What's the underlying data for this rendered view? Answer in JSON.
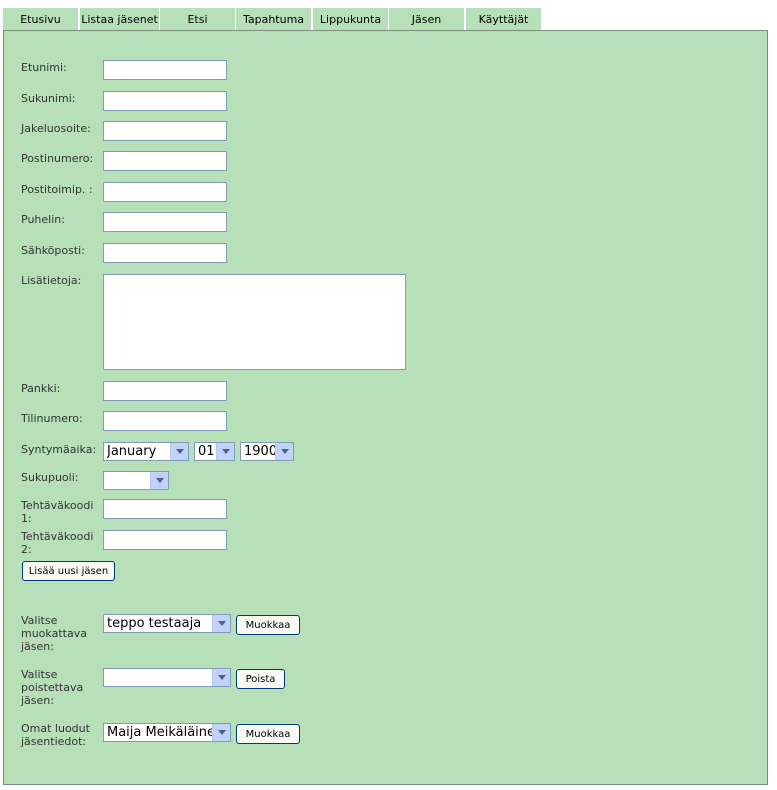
{
  "tabs": [
    "Etusivu",
    "Listaa jäsenet",
    "Etsi",
    "Tapahtuma",
    "Lippukunta",
    "Jäsen",
    "Käyttäjät"
  ],
  "form": {
    "labels": {
      "etunimi": "Etunimi:",
      "sukunimi": "Sukunimi:",
      "jakeluosoite": "Jakeluosoite:",
      "postinumero": "Postinumero:",
      "postitoimipaikka": "Postitoimip. :",
      "puhelin": "Puhelin:",
      "sahkoposti": "Sähköposti:",
      "lisatietoja": "Lisätietoja:",
      "pankki": "Pankki:",
      "tilinumero": "Tilinumero:",
      "syntymaaika": "Syntymäaika:",
      "sukupuoli": "Sukupuoli:",
      "tehtavakoodi1": "Tehtäväkoodi 1:",
      "tehtavakoodi2": "Tehtäväkoodi 2:"
    },
    "birth": {
      "month": "January",
      "day": "01",
      "year": "1900"
    },
    "gender": "",
    "add_button": "Lisää uusi jäsen"
  },
  "edit": {
    "label": "Valitse muokattava jäsen:",
    "selected": "teppo testaaja",
    "button": "Muokkaa"
  },
  "delete": {
    "label": "Valitse poistettava jäsen:",
    "selected": "",
    "button": "Poista"
  },
  "own": {
    "label": "Omat luodut jäsentiedot:",
    "selected": "Maija Meikäläinen",
    "button": "Muokkaa"
  }
}
